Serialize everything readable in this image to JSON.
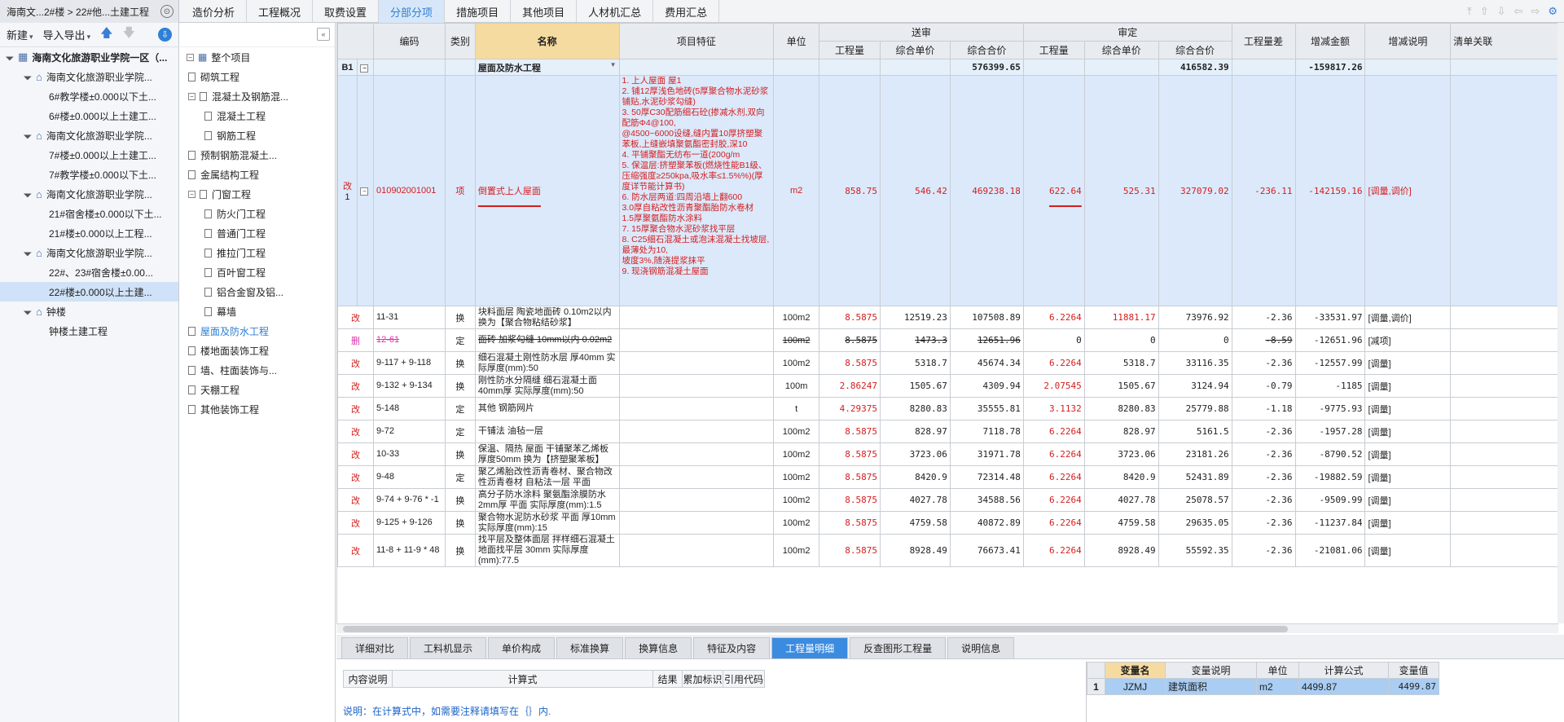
{
  "topbar": {
    "crumb": "海南文...2#楼 > 22#他...土建工程",
    "tabs": [
      "造价分析",
      "工程概况",
      "取费设置",
      "分部分项",
      "措施项目",
      "其他项目",
      "人材机汇总",
      "费用汇总"
    ],
    "active_tab": "分部分项"
  },
  "left_toolbar": {
    "new": "新建",
    "import": "导入导出"
  },
  "project_tree": [
    {
      "label": "海南文化旅游职业学院一区（...",
      "level": 0,
      "type": "root"
    },
    {
      "label": "海南文化旅游职业学院...",
      "level": 1,
      "type": "house"
    },
    {
      "label": "6#教学楼±0.000以下土...",
      "level": 2,
      "type": "leaf"
    },
    {
      "label": "6#楼±0.000以上土建工...",
      "level": 2,
      "type": "leaf"
    },
    {
      "label": "海南文化旅游职业学院...",
      "level": 1,
      "type": "house"
    },
    {
      "label": "7#楼±0.000以上土建工...",
      "level": 2,
      "type": "leaf"
    },
    {
      "label": "7#教学楼±0.000以下土...",
      "level": 2,
      "type": "leaf"
    },
    {
      "label": "海南文化旅游职业学院...",
      "level": 1,
      "type": "house"
    },
    {
      "label": "21#宿舍楼±0.000以下土...",
      "level": 2,
      "type": "leaf"
    },
    {
      "label": "21#楼±0.000以上工程...",
      "level": 2,
      "type": "leaf"
    },
    {
      "label": "海南文化旅游职业学院...",
      "level": 1,
      "type": "house"
    },
    {
      "label": "22#、23#宿舍楼±0.00...",
      "level": 2,
      "type": "leaf"
    },
    {
      "label": "22#楼±0.000以上土建...",
      "level": 2,
      "type": "leaf",
      "selected": true
    },
    {
      "label": "钟楼",
      "level": 1,
      "type": "house"
    },
    {
      "label": "钟楼土建工程",
      "level": 2,
      "type": "leaf"
    }
  ],
  "division_tree": [
    {
      "label": "整个项目",
      "level": 0,
      "box": "⊟"
    },
    {
      "label": "砌筑工程",
      "level": 1
    },
    {
      "label": "混凝土及钢筋混...",
      "level": 1,
      "box": "⊟"
    },
    {
      "label": "混凝土工程",
      "level": 2
    },
    {
      "label": "钢筋工程",
      "level": 2
    },
    {
      "label": "预制钢筋混凝土...",
      "level": 1
    },
    {
      "label": "金属结构工程",
      "level": 1
    },
    {
      "label": "门窗工程",
      "level": 1,
      "box": "⊟"
    },
    {
      "label": "防火门工程",
      "level": 2
    },
    {
      "label": "普通门工程",
      "level": 2
    },
    {
      "label": "推拉门工程",
      "level": 2
    },
    {
      "label": "百叶窗工程",
      "level": 2
    },
    {
      "label": "铝合金窗及铝...",
      "level": 2
    },
    {
      "label": "幕墙",
      "level": 2
    },
    {
      "label": "屋面及防水工程",
      "level": 1,
      "active": true
    },
    {
      "label": "楼地面装饰工程",
      "level": 1
    },
    {
      "label": "墙、柱面装饰与...",
      "level": 1
    },
    {
      "label": "天棚工程",
      "level": 1
    },
    {
      "label": "其他装饰工程",
      "level": 1
    }
  ],
  "grid": {
    "headers": {
      "code": "编码",
      "type": "类别",
      "name": "名称",
      "feature": "项目特征",
      "unit": "单位",
      "sent": "送审",
      "approved": "审定",
      "qty": "工程量",
      "uprice": "综合单价",
      "total": "综合合价",
      "qtydiff": "工程量差",
      "diff": "增减金额",
      "diffnote": "增减说明",
      "link": "清单关联"
    },
    "b1": {
      "mark": "B1",
      "name": "屋面及防水工程",
      "sent_total": "576399.65",
      "app_total": "416582.39",
      "diff": "-159817.26"
    },
    "item": {
      "mark": "改",
      "idx": "1",
      "code": "010902001001",
      "type": "项",
      "name": "倒置式上人屋面",
      "feature": [
        "1. 上人屋面 屋1",
        "2. 铺12厚浅色地砖(5厚聚合物水泥砂浆铺贴,水泥砂浆勾缝)",
        "3. 50厚C30配筋细石砼(掺减水剂,双向配筋Φ4@100,",
        "@4500~6000设缝,缝内置10厚挤塑聚苯板,上缝嵌填聚氨酯密封胶,深10",
        "4. 平铺聚酯无纺布一道(200g/m",
        "5. 保温层:挤塑聚苯板(燃烧性能B1级、压缩强度≥250kpa,吸水率≤1.5%%)(厚度详节能计算书)",
        "6. 防水层两道:四周沿墙上翻600",
        "3.0厚自粘改性沥青聚酯胎防水卷材",
        "1.5厚聚氨酯防水涂料",
        "7. 15厚聚合物水泥砂浆找平层",
        "8. C25细石混凝土或泡沫混凝土找坡层,最薄处为10,",
        "坡度3%,随浇提浆抹平",
        "9. 现浇钢筋混凝土屋面"
      ],
      "unit": "m2",
      "s_qty": "858.75",
      "s_price": "546.42",
      "s_total": "469238.18",
      "a_qty": "622.64",
      "a_price": "525.31",
      "a_total": "327079.02",
      "qdiff": "-236.11",
      "diff": "-142159.16",
      "note": "[调量,调价]"
    },
    "rows": [
      {
        "mark": "改",
        "code": "11-31",
        "type": "换",
        "name": "块料面层 陶瓷地面砖 0.10m2以内  换为【聚合物粘结砂浆】",
        "unit": "100m2",
        "s_qty": "8.5875",
        "s_price": "12519.23",
        "s_total": "107508.89",
        "a_qty": "6.2264",
        "a_price": "11881.17",
        "a_total": "73976.92",
        "qdiff": "-2.36",
        "diff": "-33531.97",
        "note": "[调量,调价]"
      },
      {
        "mark": "删",
        "code": "12-61",
        "type": "定",
        "name": "面砖 加浆勾缝 10mm以内 0.02m2",
        "unit": "100m2",
        "s_qty": "8.5875",
        "s_price": "1473.3",
        "s_total": "12651.96",
        "a_qty": "0",
        "a_price": "0",
        "a_total": "0",
        "qdiff": "-8.59",
        "diff": "-12651.96",
        "note": "[减项]",
        "deleted": true
      },
      {
        "mark": "改",
        "code": "9-117 + 9-118",
        "type": "换",
        "name": "细石混凝土刚性防水层 厚40mm  实际厚度(mm):50",
        "unit": "100m2",
        "s_qty": "8.5875",
        "s_price": "5318.7",
        "s_total": "45674.34",
        "a_qty": "6.2264",
        "a_price": "5318.7",
        "a_total": "33116.35",
        "qdiff": "-2.36",
        "diff": "-12557.99",
        "note": "[调量]"
      },
      {
        "mark": "改",
        "code": "9-132 + 9-134",
        "type": "换",
        "name": "刚性防水分隔缝 细石混凝土面 40mm厚  实际厚度(mm):50",
        "unit": "100m",
        "s_qty": "2.86247",
        "s_price": "1505.67",
        "s_total": "4309.94",
        "a_qty": "2.07545",
        "a_price": "1505.67",
        "a_total": "3124.94",
        "qdiff": "-0.79",
        "diff": "-1185",
        "note": "[调量]"
      },
      {
        "mark": "改",
        "code": "5-148",
        "type": "定",
        "name": "其他 钢筋网片",
        "unit": "t",
        "s_qty": "4.29375",
        "s_price": "8280.83",
        "s_total": "35555.81",
        "a_qty": "3.1132",
        "a_price": "8280.83",
        "a_total": "25779.88",
        "qdiff": "-1.18",
        "diff": "-9775.93",
        "note": "[调量]"
      },
      {
        "mark": "改",
        "code": "9-72",
        "type": "定",
        "name": "干铺法 油毡一层",
        "unit": "100m2",
        "s_qty": "8.5875",
        "s_price": "828.97",
        "s_total": "7118.78",
        "a_qty": "6.2264",
        "a_price": "828.97",
        "a_total": "5161.5",
        "qdiff": "-2.36",
        "diff": "-1957.28",
        "note": "[调量]"
      },
      {
        "mark": "改",
        "code": "10-33",
        "type": "换",
        "name": "保温、隔热 屋面 干铺聚苯乙烯板 厚度50mm  换为【挤塑聚苯板】",
        "unit": "100m2",
        "s_qty": "8.5875",
        "s_price": "3723.06",
        "s_total": "31971.78",
        "a_qty": "6.2264",
        "a_price": "3723.06",
        "a_total": "23181.26",
        "qdiff": "-2.36",
        "diff": "-8790.52",
        "note": "[调量]"
      },
      {
        "mark": "改",
        "code": "9-48",
        "type": "定",
        "name": "聚乙烯胎改性沥青卷材、聚合物改性沥青卷材 自粘法一层 平面",
        "unit": "100m2",
        "s_qty": "8.5875",
        "s_price": "8420.9",
        "s_total": "72314.48",
        "a_qty": "6.2264",
        "a_price": "8420.9",
        "a_total": "52431.89",
        "qdiff": "-2.36",
        "diff": "-19882.59",
        "note": "[调量]"
      },
      {
        "mark": "改",
        "code": "9-74 + 9-76 * -1",
        "type": "换",
        "name": "高分子防水涂料 聚氨酯涂膜防水 2mm厚 平面  实际厚度(mm):1.5",
        "unit": "100m2",
        "s_qty": "8.5875",
        "s_price": "4027.78",
        "s_total": "34588.56",
        "a_qty": "6.2264",
        "a_price": "4027.78",
        "a_total": "25078.57",
        "qdiff": "-2.36",
        "diff": "-9509.99",
        "note": "[调量]"
      },
      {
        "mark": "改",
        "code": "9-125 + 9-126",
        "type": "换",
        "name": "聚合物水泥防水砂浆 平面 厚10mm  实际厚度(mm):15",
        "unit": "100m2",
        "s_qty": "8.5875",
        "s_price": "4759.58",
        "s_total": "40872.89",
        "a_qty": "6.2264",
        "a_price": "4759.58",
        "a_total": "29635.05",
        "qdiff": "-2.36",
        "diff": "-11237.84",
        "note": "[调量]"
      },
      {
        "mark": "改",
        "code": "11-8 + 11-9 * 48",
        "type": "换",
        "name": "找平层及整体面层 拌样细石混凝土地面找平层 30mm  实际厚度(mm):77.5",
        "unit": "100m2",
        "s_qty": "8.5875",
        "s_price": "8928.49",
        "s_total": "76673.41",
        "a_qty": "6.2264",
        "a_price": "8928.49",
        "a_total": "55592.35",
        "qdiff": "-2.36",
        "diff": "-21081.06",
        "note": "[调量]"
      }
    ]
  },
  "bottom_tabs": [
    "详细对比",
    "工料机显示",
    "单价构成",
    "标准换算",
    "换算信息",
    "特征及内容",
    "工程量明细",
    "反查图形工程量",
    "说明信息"
  ],
  "bottom_active": "工程量明细",
  "calc": {
    "headers": [
      "内容说明",
      "计算式",
      "结果",
      "累加标识",
      "引用代码"
    ],
    "hint": "说明：在计算式中，如需要注释请填写在｛｝内."
  },
  "vars": {
    "headers": [
      "变量名",
      "变量说明",
      "单位",
      "计算公式",
      "变量值"
    ],
    "rows": [
      {
        "idx": "1",
        "name": "JZMJ",
        "desc": "建筑面积",
        "unit": "m2",
        "formula": "4499.87",
        "value": "4499.87"
      }
    ]
  }
}
